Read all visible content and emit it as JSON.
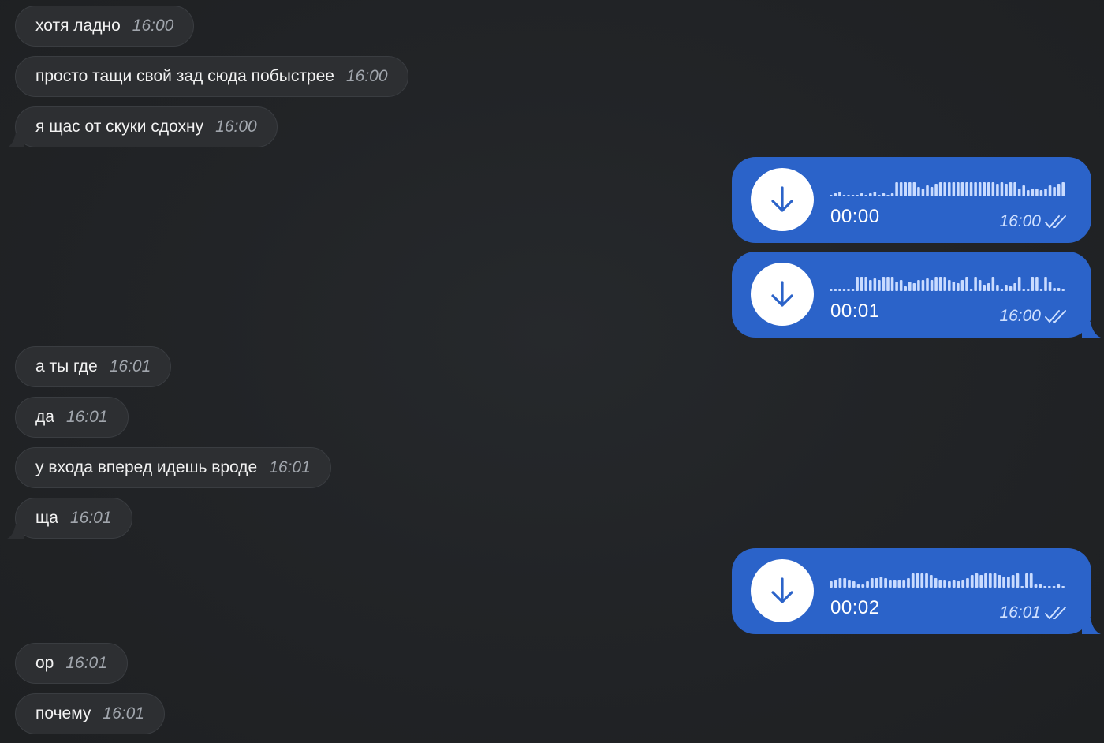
{
  "messages_in": [
    {
      "text": "хотя ладно",
      "time": "16:00"
    },
    {
      "text": "просто тащи свой зад сюда побыстрее",
      "time": "16:00"
    },
    {
      "text": "я щас от скуки сдохну",
      "time": "16:00"
    },
    {
      "text": "а ты где",
      "time": "16:01"
    },
    {
      "text": "да",
      "time": "16:01"
    },
    {
      "text": "у входа вперед идешь вроде",
      "time": "16:01"
    },
    {
      "text": "ща",
      "time": "16:01"
    },
    {
      "text": "ор",
      "time": "16:01"
    },
    {
      "text": "почему",
      "time": "16:01"
    }
  ],
  "voice_messages": [
    {
      "duration": "00:00",
      "time": "16:00",
      "status_icon": "double-check-icon",
      "action_icon": "download-arrow-icon"
    },
    {
      "duration": "00:01",
      "time": "16:00",
      "status_icon": "double-check-icon",
      "action_icon": "download-arrow-icon"
    },
    {
      "duration": "00:02",
      "time": "16:01",
      "status_icon": "double-check-icon",
      "action_icon": "download-arrow-icon"
    }
  ],
  "colors": {
    "background": "#1f2123",
    "incoming_bubble": "#2d2f32",
    "outgoing_bubble": "#2b63c9",
    "play_button": "#ffffff",
    "arrow": "#2b63c9",
    "waveform": "#c9dbff",
    "time_incoming": "#a1a6ad"
  }
}
